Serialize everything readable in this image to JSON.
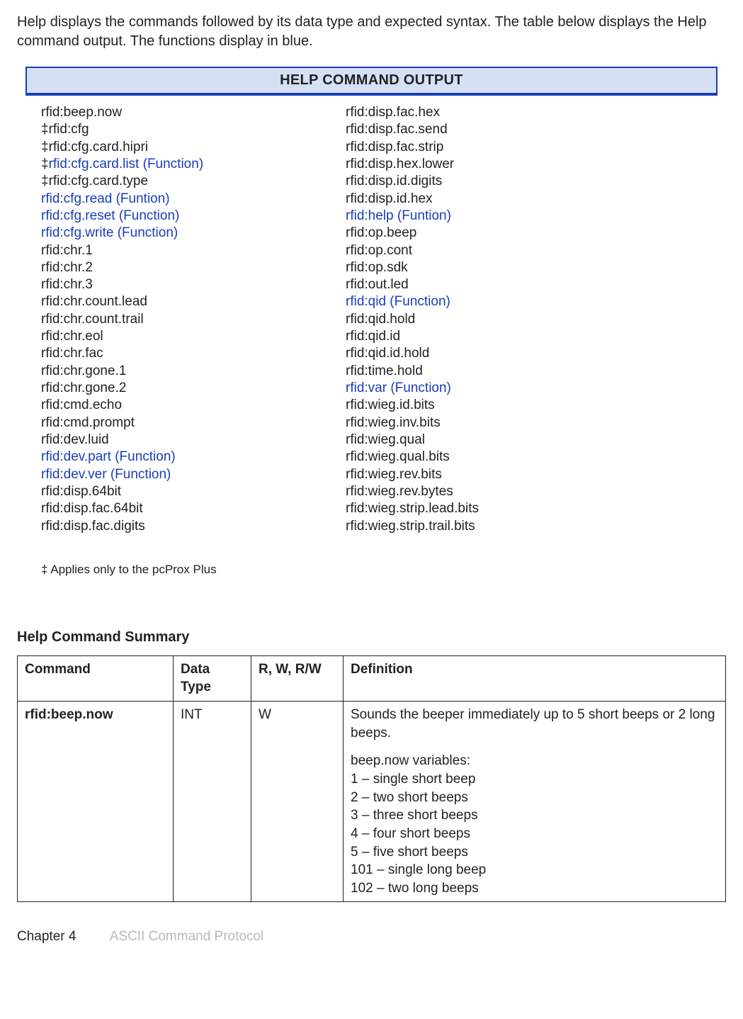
{
  "intro": "Help displays the commands followed by its data type and expected syntax. The table below displays the Help command output. The functions display in blue.",
  "output_title": "HELP COMMAND OUTPUT",
  "dagger": "‡",
  "col1": [
    {
      "prefix": "",
      "text": "rfid:beep.now",
      "func": false
    },
    {
      "prefix": "‡ ",
      "text": "rfid:cfg",
      "func": false
    },
    {
      "prefix": "‡ ",
      "text": "rfid:cfg.card.hipri",
      "func": false
    },
    {
      "prefix": "‡ ",
      "text": "rfid:cfg.card.list (Function)",
      "func": true
    },
    {
      "prefix": "‡ ",
      "text": "rfid:cfg.card.type",
      "func": false
    },
    {
      "prefix": "",
      "text": "rfid:cfg.read (Funtion)",
      "func": true
    },
    {
      "prefix": "",
      "text": "rfid:cfg.reset (Function)",
      "func": true
    },
    {
      "prefix": "",
      "text": "rfid:cfg.write (Function)",
      "func": true
    },
    {
      "prefix": "",
      "text": "rfid:chr.1",
      "func": false
    },
    {
      "prefix": "",
      "text": "rfid:chr.2",
      "func": false
    },
    {
      "prefix": "",
      "text": "rfid:chr.3",
      "func": false
    },
    {
      "prefix": "",
      "text": "rfid:chr.count.lead",
      "func": false
    },
    {
      "prefix": "",
      "text": "rfid:chr.count.trail",
      "func": false
    },
    {
      "prefix": "",
      "text": "rfid:chr.eol",
      "func": false
    },
    {
      "prefix": "",
      "text": "rfid:chr.fac",
      "func": false
    },
    {
      "prefix": "",
      "text": "rfid:chr.gone.1",
      "func": false
    },
    {
      "prefix": "",
      "text": "rfid:chr.gone.2",
      "func": false
    },
    {
      "prefix": "",
      "text": "rfid:cmd.echo",
      "func": false
    },
    {
      "prefix": "",
      "text": "rfid:cmd.prompt",
      "func": false
    },
    {
      "prefix": "",
      "text": "rfid:dev.luid",
      "func": false
    },
    {
      "prefix": "",
      "text": "rfid:dev.part (Function)",
      "func": true
    },
    {
      "prefix": "",
      "text": "rfid:dev.ver (Function)",
      "func": true
    },
    {
      "prefix": "",
      "text": "rfid:disp.64bit",
      "func": false
    },
    {
      "prefix": "",
      "text": "rfid:disp.fac.64bit",
      "func": false
    },
    {
      "prefix": "",
      "text": "rfid:disp.fac.digits",
      "func": false
    }
  ],
  "col2": [
    {
      "text": "rfid:disp.fac.hex",
      "func": false
    },
    {
      "text": "rfid:disp.fac.send",
      "func": false
    },
    {
      "text": "rfid:disp.fac.strip",
      "func": false
    },
    {
      "text": "rfid:disp.hex.lower",
      "func": false
    },
    {
      "text": "rfid:disp.id.digits",
      "func": false
    },
    {
      "text": "rfid:disp.id.hex",
      "func": false
    },
    {
      "text": "rfid:help (Funtion)",
      "func": true
    },
    {
      "text": "rfid:op.beep",
      "func": false
    },
    {
      "text": "rfid:op.cont",
      "func": false
    },
    {
      "text": "rfid:op.sdk",
      "func": false
    },
    {
      "text": "rfid:out.led",
      "func": false
    },
    {
      "text": "rfid:qid (Function)",
      "func": true
    },
    {
      "text": "rfid:qid.hold",
      "func": false
    },
    {
      "text": "rfid:qid.id",
      "func": false
    },
    {
      "text": "rfid:qid.id.hold",
      "func": false
    },
    {
      "text": "rfid:time.hold",
      "func": false
    },
    {
      "text": "rfid:var (Function)",
      "func": true
    },
    {
      "text": "rfid:wieg.id.bits",
      "func": false
    },
    {
      "text": "rfid:wieg.inv.bits",
      "func": false
    },
    {
      "text": "rfid:wieg.qual",
      "func": false
    },
    {
      "text": "rfid:wieg.qual.bits",
      "func": false
    },
    {
      "text": "rfid:wieg.rev.bits",
      "func": false
    },
    {
      "text": "rfid:wieg.rev.bytes",
      "func": false
    },
    {
      "text": "rfid:wieg.strip.lead.bits",
      "func": false
    },
    {
      "text": "rfid:wieg.strip.trail.bits",
      "func": false
    }
  ],
  "footnote": "‡ Applies only to the pcProx Plus",
  "section_heading": "Help Command Summary",
  "table": {
    "headers": [
      "Command",
      "Data Type",
      "R, W, R/W",
      "Definition"
    ],
    "row": {
      "command": "rfid:beep.now",
      "datatype": "INT",
      "rw": "W",
      "def_lead": "Sounds the beeper immediately up to 5 short beeps or 2 long beeps.",
      "vars_head": "beep.now variables:",
      "vars": [
        "1 – single short beep",
        "2 – two short beeps",
        "3 – three short beeps",
        "4 – four short beeps",
        "5 – five short beeps",
        "101 – single long beep",
        "102 – two long beeps"
      ]
    }
  },
  "footer": {
    "chapter": "Chapter 4",
    "title": "ASCII Command Protocol"
  }
}
